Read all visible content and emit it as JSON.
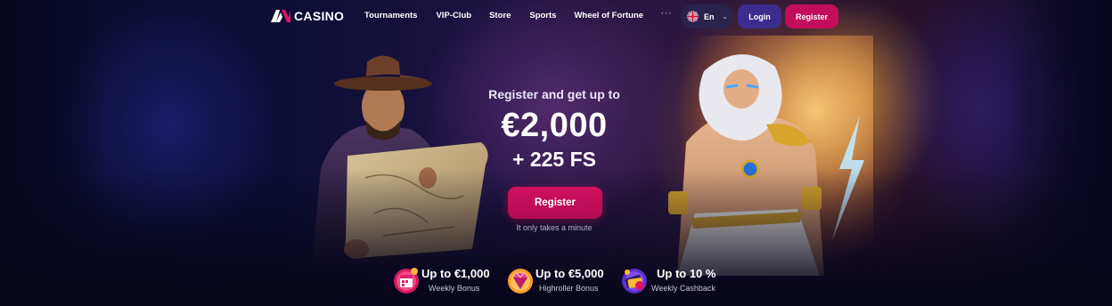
{
  "brand": {
    "name": "CASINO",
    "logo_icon": "av-logo-icon"
  },
  "nav": {
    "items": [
      "Tournaments",
      "VIP-Club",
      "Store",
      "Sports",
      "Wheel of Fortune"
    ],
    "more": "···"
  },
  "header": {
    "language": "En",
    "language_icon": "uk-flag-icon",
    "login_label": "Login",
    "register_label": "Register"
  },
  "promo": {
    "subtitle": "Register and get up to",
    "amount": "€2,000",
    "free_spins": "+ 225 FS",
    "cta_label": "Register",
    "note": "It only takes a minute"
  },
  "bonuses": [
    {
      "title": "Up to €1,000",
      "label": "Weekly Bonus",
      "icon": "calendar-icon"
    },
    {
      "title": "Up to €5,000",
      "label": "Highroller Bonus",
      "icon": "diamond-icon"
    },
    {
      "title": "Up to 10 %",
      "label": "Weekly Cashback",
      "icon": "cashback-icon"
    }
  ],
  "colors": {
    "register": "#c20e5a",
    "login": "#3b2c8e",
    "background": "#06061a"
  }
}
